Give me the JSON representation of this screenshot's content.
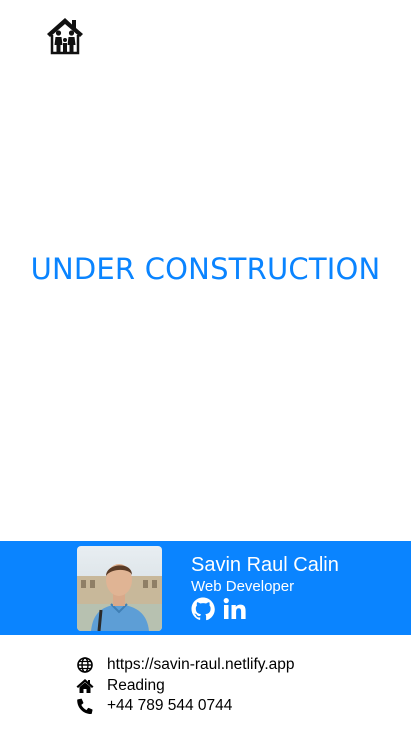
{
  "colors": {
    "accent": "#0a84ff",
    "card_background": "#0a84ff",
    "text_dark": "#000000",
    "text_light": "#ffffff"
  },
  "header": {
    "logo_icon": "family-house-icon"
  },
  "main": {
    "headline": "UNDER CONSTRUCTION"
  },
  "profile": {
    "avatar_icon": "profile-photo",
    "name": "Savin Raul Calin",
    "role": "Web Developer",
    "social_icons": [
      "github-icon",
      "linkedin-icon"
    ]
  },
  "contact": {
    "website": {
      "icon": "globe-icon",
      "text": "https://savin-raul.netlify.app"
    },
    "location": {
      "icon": "home-icon",
      "text": "Reading"
    },
    "phone": {
      "icon": "phone-icon",
      "text": "+44 789 544 0744"
    }
  }
}
